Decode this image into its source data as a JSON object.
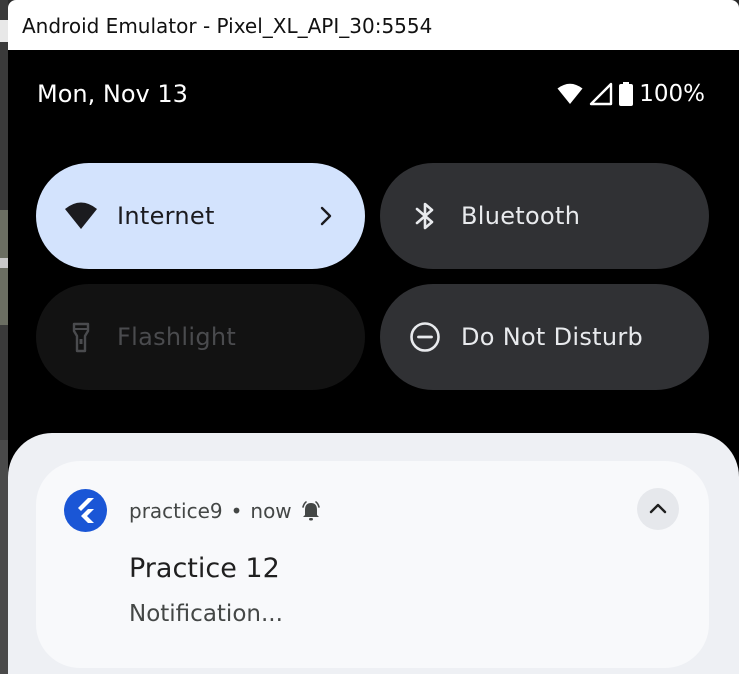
{
  "window": {
    "title": "Android Emulator - Pixel_XL_API_30:5554"
  },
  "status_bar": {
    "date": "Mon, Nov 13",
    "battery_percent": "100%",
    "icons": [
      "wifi-icon",
      "cellular-signal-icon",
      "battery-icon"
    ]
  },
  "quick_settings": {
    "tiles": [
      {
        "label": "Internet",
        "icon": "wifi-icon",
        "state": "active",
        "has_chevron": true
      },
      {
        "label": "Bluetooth",
        "icon": "bluetooth-icon",
        "state": "inactive"
      },
      {
        "label": "Flashlight",
        "icon": "flashlight-icon",
        "state": "unavailable"
      },
      {
        "label": "Do Not Disturb",
        "icon": "do-not-disturb-icon",
        "state": "inactive"
      }
    ]
  },
  "notification": {
    "app_name": "practice9",
    "separator": "•",
    "time": "now",
    "alert_icon": "bell-icon",
    "title": "Practice 12",
    "text": "Notification...",
    "app_icon": "flutter-icon",
    "expand_icon": "chevron-up-icon"
  },
  "colors": {
    "active_tile": "#d3e3fd",
    "inactive_tile": "#303134",
    "unavailable_tile": "#121212",
    "app_icon_bg": "#1a56d6",
    "shade_bg": "#eef0f4"
  }
}
